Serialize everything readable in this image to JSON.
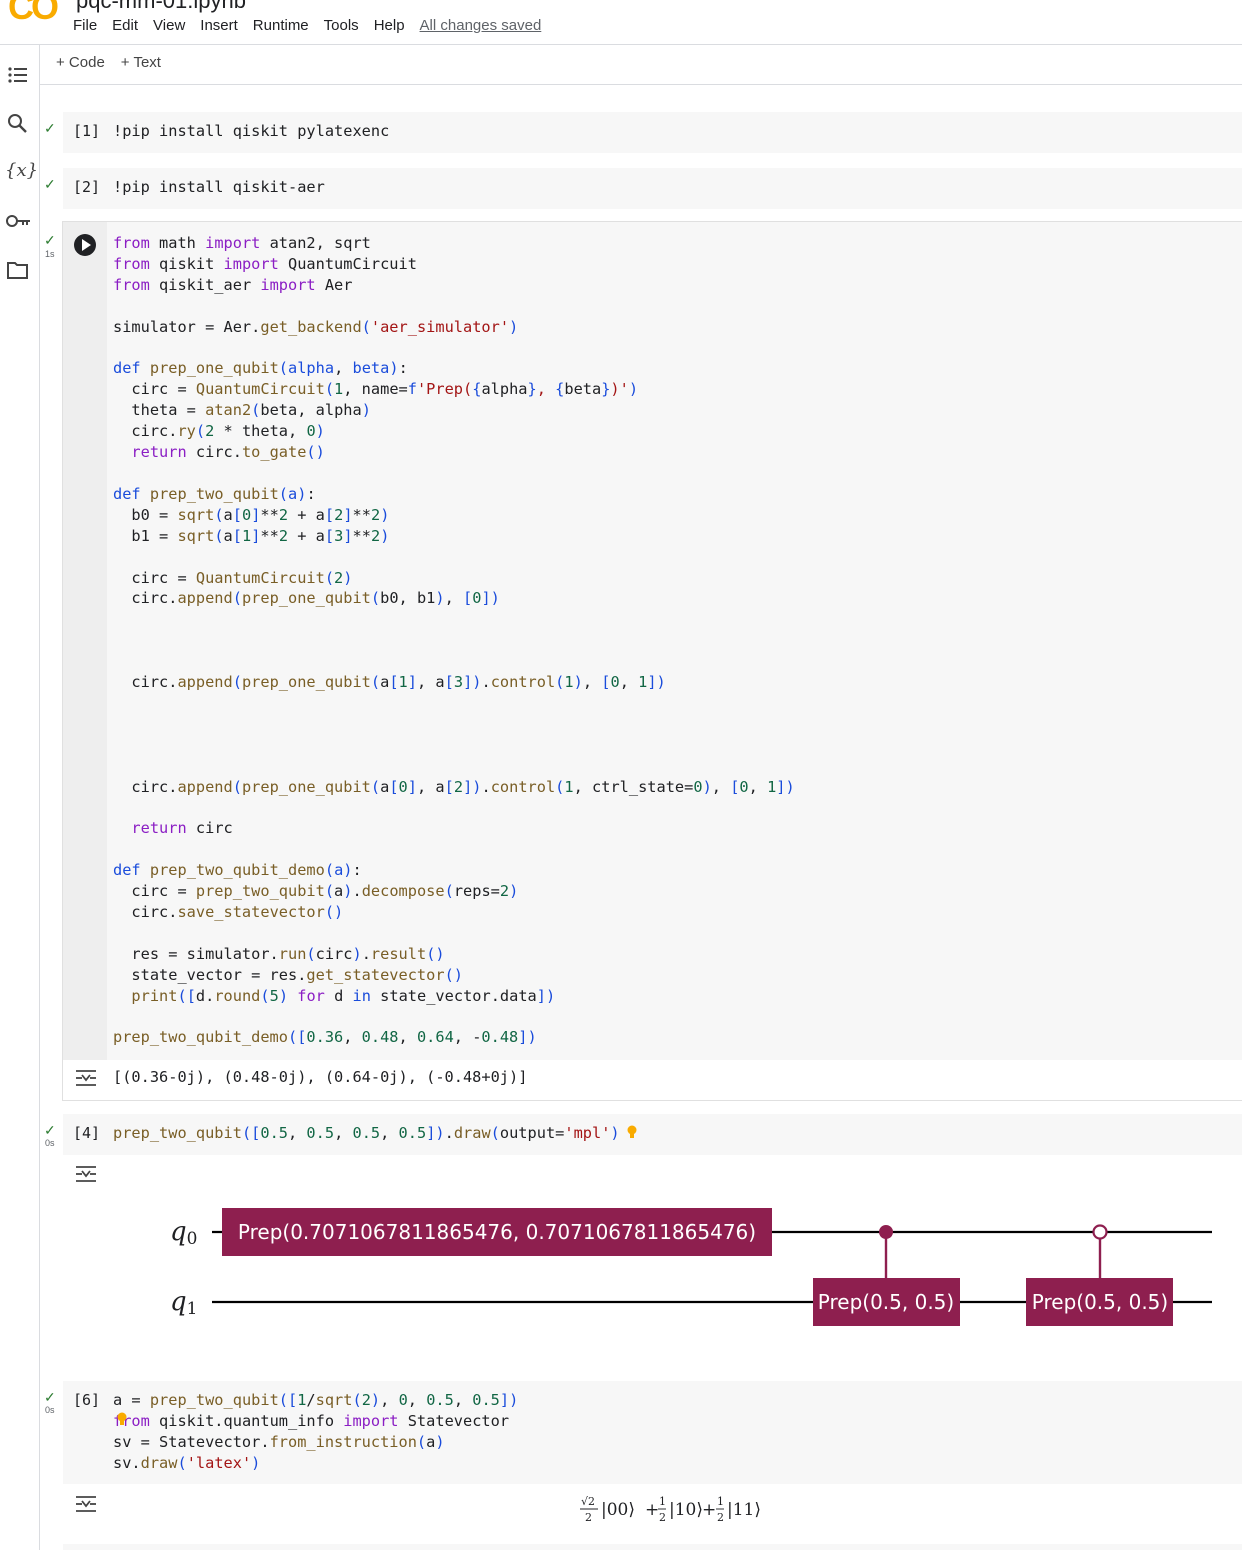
{
  "header": {
    "logo": "CO",
    "title_fragment": "pqc-mm-01.ipynb",
    "menu": [
      "File",
      "Edit",
      "View",
      "Insert",
      "Runtime",
      "Tools",
      "Help"
    ],
    "save_status": "All changes saved"
  },
  "toolbar": {
    "add_code": "+ Code",
    "add_text": "+ Text"
  },
  "sidebar": {
    "icons": [
      "table-of-contents-icon",
      "search-icon",
      "variables-icon",
      "key-icon",
      "folder-icon"
    ],
    "variables_glyph": "{x}"
  },
  "cells": {
    "c1": {
      "exec": "[1]",
      "code": "!pip install qiskit pylatexenc"
    },
    "c2": {
      "exec": "[2]",
      "code": "!pip install qiskit-aer"
    },
    "c3": {
      "timing": "1s",
      "output": "[(0.36-0j), (0.48-0j), (0.64-0j), (-0.48+0j)]"
    },
    "c4": {
      "exec": "[4]",
      "timing": "0s"
    },
    "c6": {
      "exec": "[6]",
      "timing": "0s"
    }
  },
  "circuit": {
    "q0_label": "q",
    "q0_sub": "0",
    "q1_label": "q",
    "q1_sub": "1",
    "gate1": "Prep(0.7071067811865476, 0.7071067811865476)",
    "gate2": "Prep(0.5, 0.5)",
    "gate3": "Prep(0.5, 0.5)",
    "gate_color": "#8e1f4f"
  },
  "latex_output": {
    "sqrt": "√2",
    "den2": "2",
    "one": "1",
    "k00": "|00⟩",
    "k10": "|10⟩",
    "k11": "|11⟩",
    "plus": "+"
  },
  "colors": {
    "keyword": "#8b1ec4",
    "string": "#a31515",
    "number": "#116644",
    "check": "#2e7d32"
  }
}
